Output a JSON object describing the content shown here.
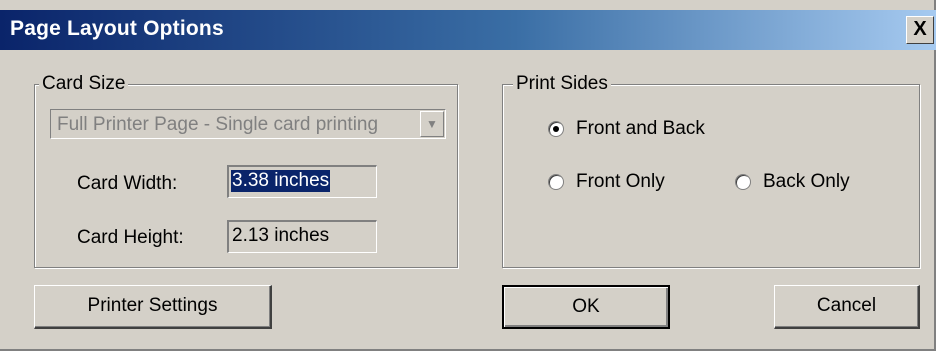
{
  "window": {
    "title": "Page Layout Options",
    "close_glyph": "X"
  },
  "card_size": {
    "legend": "Card Size",
    "combo_value": "Full Printer Page - Single card printing",
    "width_label": "Card Width:",
    "width_value": "3.38 inches",
    "height_label": "Card Height:",
    "height_value": "2.13 inches"
  },
  "print_sides": {
    "legend": "Print Sides",
    "options": [
      {
        "label": "Front and Back",
        "selected": true
      },
      {
        "label": "Front Only",
        "selected": false
      },
      {
        "label": "Back Only",
        "selected": false
      }
    ]
  },
  "buttons": {
    "printer_settings": "Printer Settings",
    "ok": "OK",
    "cancel": "Cancel"
  },
  "colors": {
    "title_start": "#0a246a",
    "title_end": "#a6caf0",
    "face": "#d4d0c8",
    "selection": "#0a246a"
  },
  "icons": {
    "combo_arrow": "chevron-down-icon",
    "close": "close-icon"
  }
}
